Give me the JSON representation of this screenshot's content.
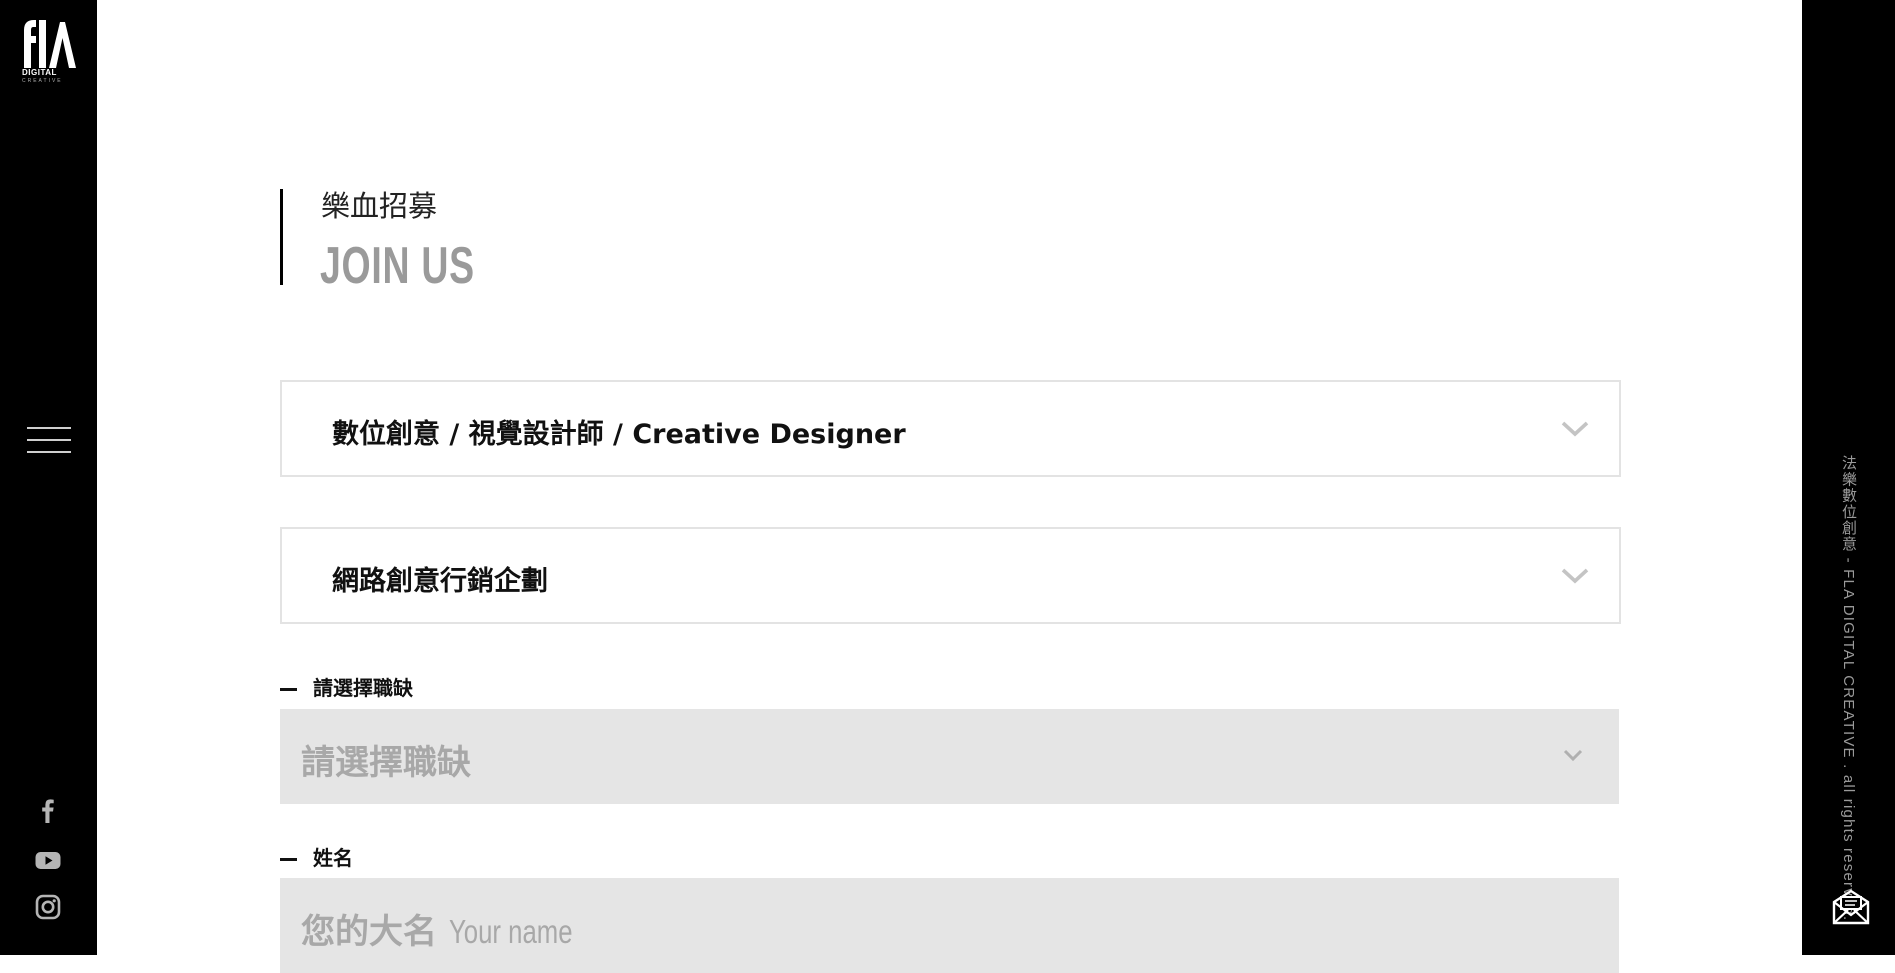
{
  "brand": {
    "logo_name": "FLA",
    "logo_text": "DIGITAL",
    "logo_subtext": "CREATIVE"
  },
  "sidebar": {
    "menu_icon": "hamburger-icon",
    "social": [
      {
        "name": "facebook",
        "icon": "facebook-icon"
      },
      {
        "name": "youtube",
        "icon": "youtube-icon"
      },
      {
        "name": "instagram",
        "icon": "instagram-icon"
      }
    ]
  },
  "right_bar": {
    "copyright": "法樂數位創意 - FLA DIGITAL CREATIVE . all rights reserved.",
    "mail_icon": "mail-icon"
  },
  "page": {
    "title_zh": "樂血招募",
    "title_en": "JOIN US"
  },
  "jobs": [
    {
      "title": "數位創意 / 視覺設計師 / Creative Designer"
    },
    {
      "title": "網路創意行銷企劃"
    }
  ],
  "form": {
    "position": {
      "label": "請選擇職缺",
      "placeholder": "請選擇職缺"
    },
    "name": {
      "label": "姓名",
      "placeholder_zh": "您的大名",
      "placeholder_en": "Your name"
    }
  },
  "colors": {
    "sidebar_bg": "#000000",
    "accent_gray": "#9a9a9a",
    "field_bg": "#e5e5e5",
    "border": "#e3e3e3"
  }
}
